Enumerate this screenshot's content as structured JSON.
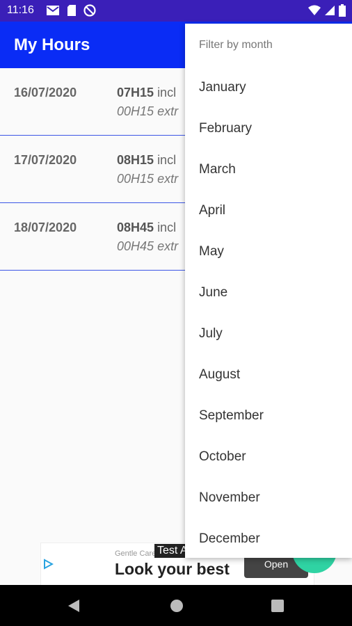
{
  "status_bar": {
    "time": "11:16"
  },
  "app_bar": {
    "title": "My Hours"
  },
  "entries": [
    {
      "date": "16/07/2020",
      "hours": "07H15",
      "hours_suffix": "incl",
      "extra": "00H15",
      "extra_suffix": "extr"
    },
    {
      "date": "17/07/2020",
      "hours": "08H15",
      "hours_suffix": "incl",
      "extra": "00H15",
      "extra_suffix": "extr"
    },
    {
      "date": "18/07/2020",
      "hours": "08H45",
      "hours_suffix": "incl",
      "extra": "00H45",
      "extra_suffix": "extr"
    }
  ],
  "filter_menu": {
    "header": "Filter by month",
    "months": [
      "January",
      "February",
      "March",
      "April",
      "May",
      "June",
      "July",
      "August",
      "September",
      "October",
      "November",
      "December"
    ]
  },
  "ad": {
    "brand": "Gentle Care",
    "headline": "Look your best",
    "button": "Open",
    "test_label": "Test A"
  },
  "colors": {
    "status_bar": "#3a1fb8",
    "app_bar": "#0a2cf5",
    "fab": "#2fd3a3",
    "divider": "#3b55e6"
  }
}
